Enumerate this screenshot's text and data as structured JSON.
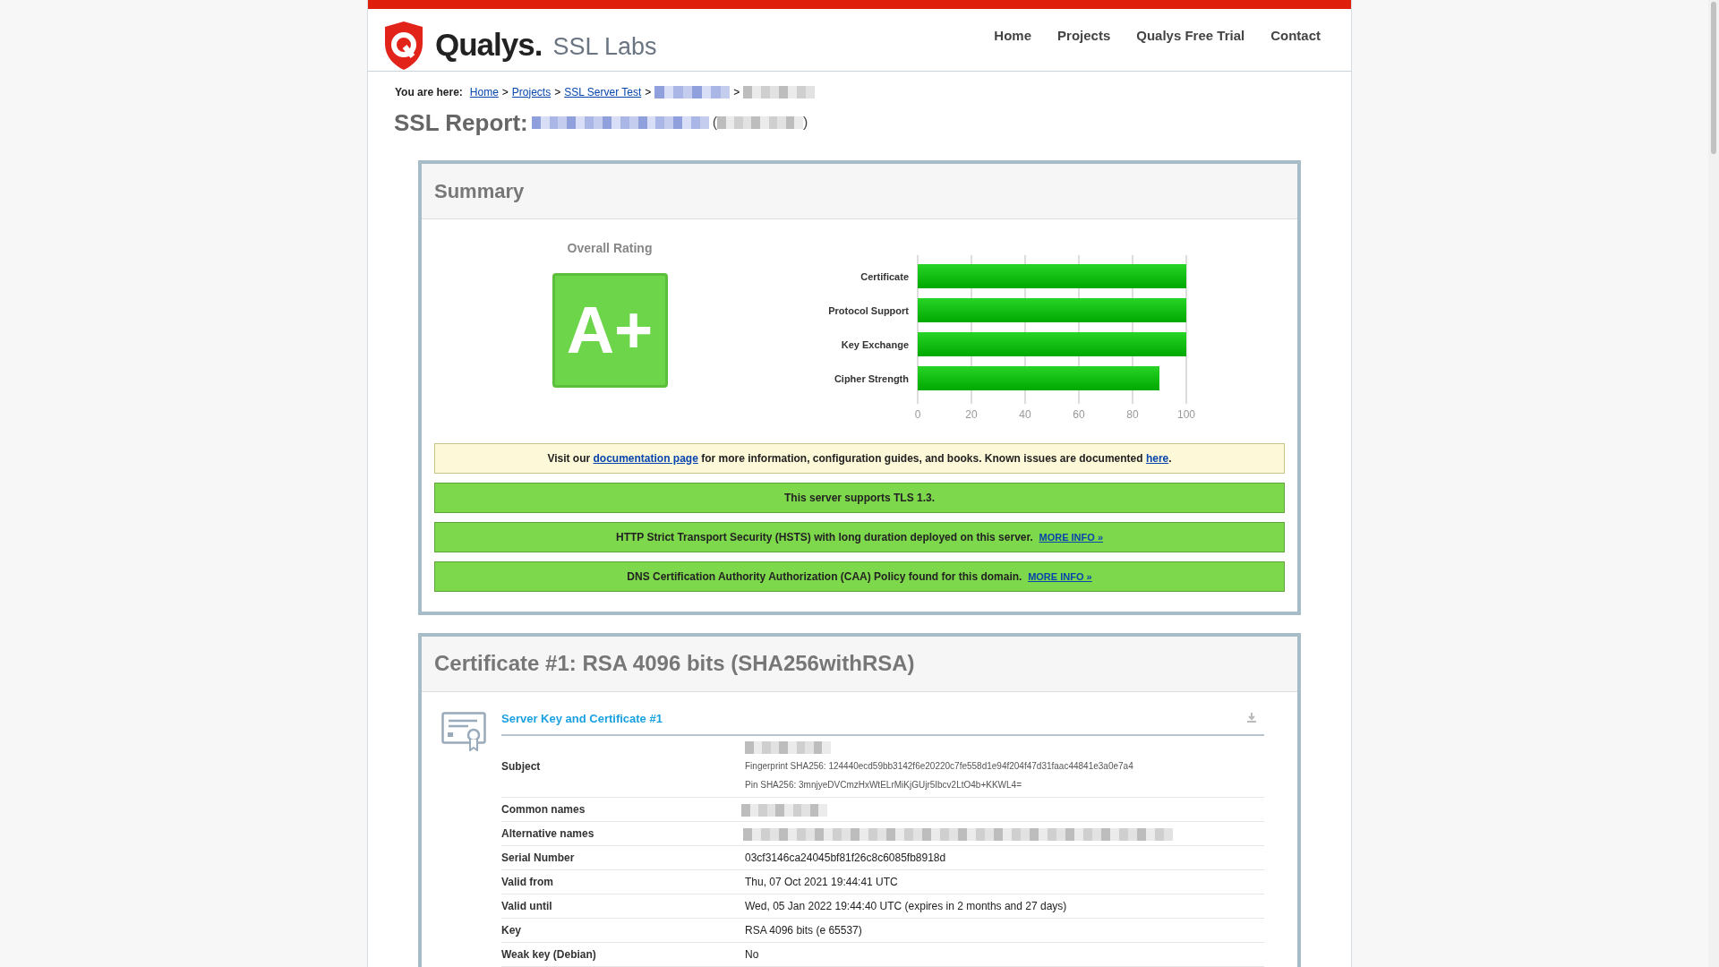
{
  "header": {
    "brand": "Qualys.",
    "product": "SSL Labs",
    "nav": [
      {
        "label": "Home"
      },
      {
        "label": "Projects"
      },
      {
        "label": "Qualys Free Trial"
      },
      {
        "label": "Contact"
      }
    ]
  },
  "breadcrumb": {
    "prefix": "You are here:",
    "links": [
      "Home",
      "Projects",
      "SSL Server Test"
    ],
    "separators": [
      ">",
      ">",
      ">",
      ">"
    ]
  },
  "report_title": "SSL Report:",
  "address_brackets": [
    "(",
    ")"
  ],
  "summary": {
    "title": "Summary",
    "rating_label": "Overall Rating",
    "grade": "A+",
    "chart_data": {
      "type": "bar",
      "orientation": "horizontal",
      "categories": [
        "Certificate",
        "Protocol Support",
        "Key Exchange",
        "Cipher Strength"
      ],
      "values": [
        100,
        100,
        100,
        90
      ],
      "xlim": [
        0,
        100
      ],
      "grid": true,
      "xticks": [
        0,
        20,
        40,
        60,
        80,
        100
      ]
    },
    "notices": [
      {
        "kind": "info",
        "parts": [
          {
            "kind": "text",
            "text": "Visit our "
          },
          {
            "kind": "link",
            "text": "documentation page"
          },
          {
            "kind": "text",
            "text": " for more information, configuration guides, and books. Known issues are documented "
          },
          {
            "kind": "link",
            "text": "here"
          },
          {
            "kind": "text",
            "text": "."
          }
        ]
      },
      {
        "kind": "good",
        "parts": [
          {
            "kind": "text",
            "text": "This server supports TLS 1.3."
          }
        ]
      },
      {
        "kind": "good",
        "parts": [
          {
            "kind": "text",
            "text": "HTTP Strict Transport Security (HSTS) with long duration deployed on this server.  "
          },
          {
            "kind": "link",
            "text": "MORE INFO »"
          }
        ]
      },
      {
        "kind": "good",
        "parts": [
          {
            "kind": "text",
            "text": "DNS Certification Authority Authorization (CAA) Policy found for this domain.  "
          },
          {
            "kind": "link",
            "text": "MORE INFO »"
          }
        ]
      }
    ]
  },
  "certificate": {
    "title": "Certificate #1: RSA 4096 bits (SHA256withRSA)",
    "section_title": "Server Key and Certificate #1",
    "rows": [
      {
        "kind": "subject",
        "label": "Subject",
        "lines": [
          "Fingerprint SHA256: 124440ecd59bb3142f6e20220c7fe558d1e94f204f47d31faac44841e3a0e7a4",
          "Pin SHA256: 3mnjyeDVCmzHxWtELrMiKjGUjr5Ibcv2LtO4b+KKWL4="
        ]
      },
      {
        "kind": "redacted",
        "label": "Common names"
      },
      {
        "kind": "redacted_long",
        "label": "Alternative names"
      },
      {
        "kind": "text",
        "label": "Serial Number",
        "value": "03cf3146ca24045bf81f26c8c6085fb8918d"
      },
      {
        "kind": "text",
        "label": "Valid from",
        "value": "Thu, 07 Oct 2021 19:44:41 UTC"
      },
      {
        "kind": "text",
        "label": "Valid until",
        "value": "Wed, 05 Jan 2022 19:44:40 UTC (expires in 2 months and 27 days)"
      },
      {
        "kind": "text",
        "label": "Key",
        "value": "RSA 4096 bits (e 65537)"
      },
      {
        "kind": "text",
        "label": "Weak key (Debian)",
        "value": "No"
      }
    ]
  }
}
